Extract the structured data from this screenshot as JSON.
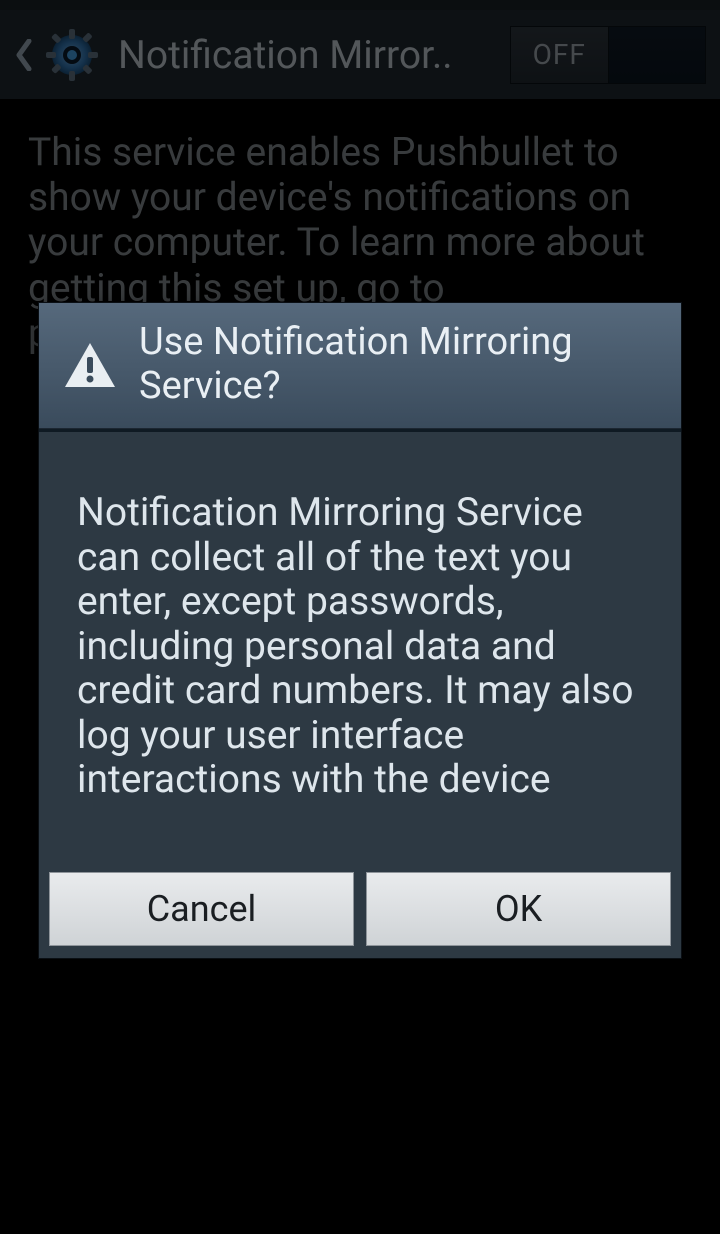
{
  "header": {
    "title": "Notification Mirror..",
    "toggle": {
      "state": "off",
      "off_label": "OFF",
      "on_label": ""
    }
  },
  "page": {
    "description": "This service enables Pushbullet to show your device's notifications on your computer. To learn more about getting this set up, go to pushbullet.com."
  },
  "dialog": {
    "title": "Use Notification Mirroring Service?",
    "message": "Notification Mirroring Service can collect all of the text you enter, except passwords, including personal data and credit card numbers. It may also log your user interface interactions with the device",
    "cancel_label": "Cancel",
    "ok_label": "OK"
  }
}
